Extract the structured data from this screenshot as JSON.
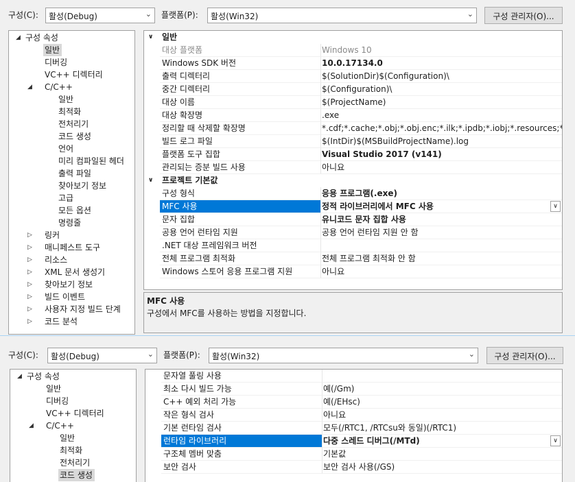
{
  "top": {
    "config_label": "구성(C):",
    "config_value": "활성(Debug)",
    "platform_label": "플랫폼(P):",
    "platform_value": "활성(Win32)",
    "config_manager": "구성 관리자(O)..."
  },
  "tree1": [
    {
      "label": "구성 속성",
      "level": 0,
      "arrow": "down"
    },
    {
      "label": "일반",
      "level": 1,
      "selected": true
    },
    {
      "label": "디버깅",
      "level": 1
    },
    {
      "label": "VC++ 디렉터리",
      "level": 1
    },
    {
      "label": "C/C++",
      "level": 1,
      "arrow": "down"
    },
    {
      "label": "일반",
      "level": 2
    },
    {
      "label": "최적화",
      "level": 2
    },
    {
      "label": "전처리기",
      "level": 2
    },
    {
      "label": "코드 생성",
      "level": 2
    },
    {
      "label": "언어",
      "level": 2
    },
    {
      "label": "미리 컴파일된 헤더",
      "level": 2
    },
    {
      "label": "출력 파일",
      "level": 2
    },
    {
      "label": "찾아보기 정보",
      "level": 2
    },
    {
      "label": "고급",
      "level": 2
    },
    {
      "label": "모든 옵션",
      "level": 2
    },
    {
      "label": "명령줄",
      "level": 2
    },
    {
      "label": "링커",
      "level": 1,
      "arrow": "right"
    },
    {
      "label": "매니페스트 도구",
      "level": 1,
      "arrow": "right"
    },
    {
      "label": "리소스",
      "level": 1,
      "arrow": "right"
    },
    {
      "label": "XML 문서 생성기",
      "level": 1,
      "arrow": "right"
    },
    {
      "label": "찾아보기 정보",
      "level": 1,
      "arrow": "right"
    },
    {
      "label": "빌드 이벤트",
      "level": 1,
      "arrow": "right"
    },
    {
      "label": "사용자 지정 빌드 단계",
      "level": 1,
      "arrow": "right"
    },
    {
      "label": "코드 분석",
      "level": 1,
      "arrow": "right"
    }
  ],
  "grid1": [
    {
      "cat": true,
      "label": "일반"
    },
    {
      "name": "대상 플랫폼",
      "value": "Windows 10",
      "disabled": true
    },
    {
      "name": "Windows SDK 버전",
      "value": "10.0.17134.0",
      "bold": true
    },
    {
      "name": "출력 디렉터리",
      "value": "$(SolutionDir)$(Configuration)\\"
    },
    {
      "name": "중간 디렉터리",
      "value": "$(Configuration)\\"
    },
    {
      "name": "대상 이름",
      "value": "$(ProjectName)"
    },
    {
      "name": "대상 확장명",
      "value": ".exe"
    },
    {
      "name": "정리할 때 삭제할 확장명",
      "value": "*.cdf;*.cache;*.obj;*.obj.enc;*.ilk;*.ipdb;*.iobj;*.resources;*.tlb;*.tli;*."
    },
    {
      "name": "빌드 로그 파일",
      "value": "$(IntDir)$(MSBuildProjectName).log"
    },
    {
      "name": "플랫폼 도구 집합",
      "value": "Visual Studio 2017 (v141)",
      "bold": true
    },
    {
      "name": "관리되는 증분 빌드 사용",
      "value": "아니요"
    },
    {
      "cat": true,
      "label": "프로젝트 기본값"
    },
    {
      "name": "구성 형식",
      "value": "응용 프로그램(.exe)",
      "bold": true
    },
    {
      "name": "MFC 사용",
      "value": "정적 라이브러리에서 MFC 사용",
      "bold": true,
      "selected": true
    },
    {
      "name": "문자 집합",
      "value": "유니코드 문자 집합 사용",
      "bold": true
    },
    {
      "name": "공용 언어 런타임 지원",
      "value": "공용 언어 런타임 지원 안 함"
    },
    {
      "name": ".NET 대상 프레임워크 버전",
      "value": ""
    },
    {
      "name": "전체 프로그램 최적화",
      "value": "전체 프로그램 최적화 안 함"
    },
    {
      "name": "Windows 스토어 응용 프로그램 지원",
      "value": "아니요"
    }
  ],
  "desc": {
    "title": "MFC 사용",
    "text": "구성에서 MFC를 사용하는 방법을 지정합니다."
  },
  "tree2": [
    {
      "label": "구성 속성",
      "level": 0,
      "arrow": "down"
    },
    {
      "label": "일반",
      "level": 1
    },
    {
      "label": "디버깅",
      "level": 1
    },
    {
      "label": "VC++ 디렉터리",
      "level": 1
    },
    {
      "label": "C/C++",
      "level": 1,
      "arrow": "down"
    },
    {
      "label": "일반",
      "level": 2
    },
    {
      "label": "최적화",
      "level": 2
    },
    {
      "label": "전처리기",
      "level": 2
    },
    {
      "label": "코드 생성",
      "level": 2,
      "selected": true
    }
  ],
  "grid2": [
    {
      "name": "문자열 풀링 사용",
      "value": ""
    },
    {
      "name": "최소 다시 빌드 가능",
      "value": "예(/Gm)"
    },
    {
      "name": "C++ 예외 처리 가능",
      "value": "예(/EHsc)"
    },
    {
      "name": "작은 형식 검사",
      "value": "아니요"
    },
    {
      "name": "기본 런타임 검사",
      "value": "모두(/RTC1, /RTCsu와 동일)(/RTC1)"
    },
    {
      "name": "런타임 라이브러리",
      "value": "다중 스레드 디버그(/MTd)",
      "bold": true,
      "selected": true
    },
    {
      "name": "구조체 멤버 맞춤",
      "value": "기본값"
    },
    {
      "name": "보안 검사",
      "value": "보안 검사 사용(/GS)"
    }
  ]
}
